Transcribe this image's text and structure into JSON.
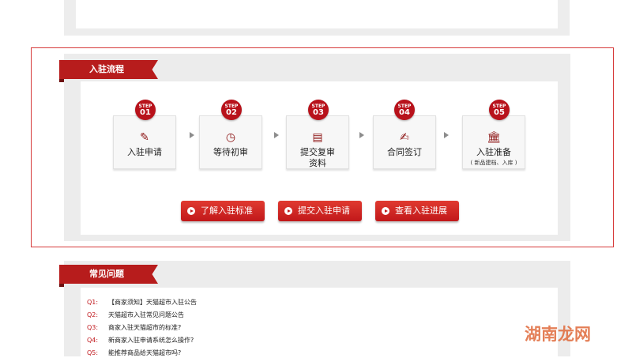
{
  "process": {
    "title": "入驻流程",
    "steps": [
      {
        "step_word": "STEP",
        "num": "01",
        "label": "入驻申请",
        "icon": "pen-icon",
        "glyph": "✎"
      },
      {
        "step_word": "STEP",
        "num": "02",
        "label": "等待初审",
        "icon": "clock-icon",
        "glyph": "◷"
      },
      {
        "step_word": "STEP",
        "num": "03",
        "label": "提交复审",
        "label2": "资料",
        "icon": "document-icon",
        "glyph": "▤"
      },
      {
        "step_word": "STEP",
        "num": "04",
        "label": "合同签订",
        "icon": "contract-icon",
        "glyph": "✍"
      },
      {
        "step_word": "STEP",
        "num": "05",
        "label": "入驻准备",
        "sublabel": "( 新品建档、入库 )",
        "icon": "building-icon",
        "glyph": "🏛"
      }
    ],
    "buttons": {
      "learn": "了解入驻标准",
      "submit": "提交入驻申请",
      "check": "查看入驻进展"
    }
  },
  "faq": {
    "title": "常见问题",
    "items": [
      {
        "q": "Q1:",
        "text": "【商家须知】天猫超市入驻公告"
      },
      {
        "q": "Q2:",
        "text": "天猫超市入驻常见问题公告"
      },
      {
        "q": "Q3:",
        "text": "商家入驻天猫超市的标准?"
      },
      {
        "q": "Q4:",
        "text": "新商家入驻申请系统怎么操作?"
      },
      {
        "q": "Q5:",
        "text": "能推荐商品给天猫超市吗?"
      }
    ]
  },
  "watermark": "湖南龙网",
  "colors": {
    "accent": "#b71c1c",
    "frame": "#d63a3a",
    "panel": "#ececec"
  }
}
